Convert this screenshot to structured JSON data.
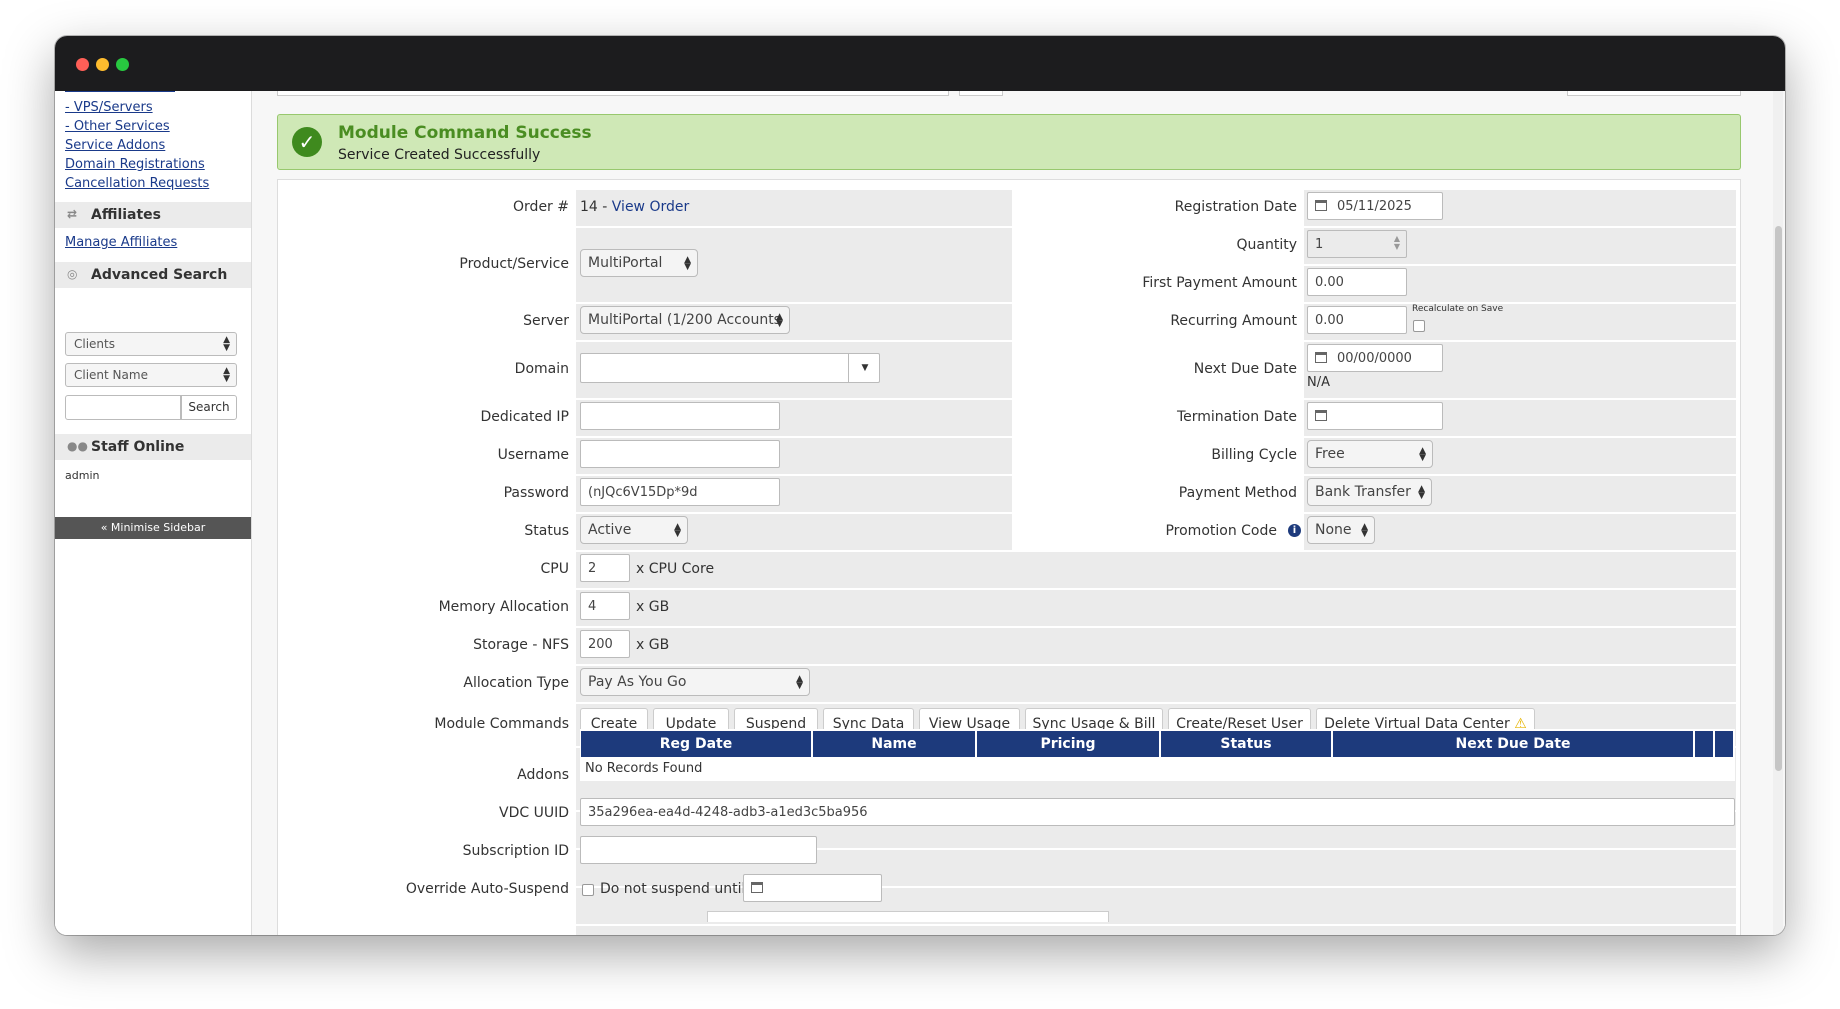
{
  "sidebar": {
    "links_top": [
      "- VPS/Servers",
      "- Other Services",
      "Service Addons",
      "Domain Registrations",
      "Cancellation Requests"
    ],
    "affiliates": {
      "title": "Affiliates",
      "link": "Manage Affiliates"
    },
    "advanced_search": {
      "title": "Advanced Search",
      "select1": "Clients",
      "select2": "Client Name",
      "search_button": "Search"
    },
    "staff_online": {
      "title": "Staff Online",
      "user": "admin"
    },
    "minimise": "« Minimise Sidebar"
  },
  "alert": {
    "title": "Module Command Success",
    "message": "Service Created Successfully"
  },
  "form": {
    "order_label": "Order #",
    "order_number": "14 - ",
    "view_order": "View Order",
    "product_label": "Product/Service",
    "product_value": "MultiPortal",
    "server_label": "Server",
    "server_value": "MultiPortal (1/200 Accounts",
    "domain_label": "Domain",
    "domain_value": "",
    "dedicated_ip_label": "Dedicated IP",
    "dedicated_ip_value": "",
    "username_label": "Username",
    "username_value": "",
    "password_label": "Password",
    "password_value": "(nJQc6V15Dp*9d",
    "status_label": "Status",
    "status_value": "Active",
    "registration_date_label": "Registration Date",
    "registration_date_value": "05/11/2025",
    "quantity_label": "Quantity",
    "quantity_value": "1",
    "first_payment_label": "First Payment Amount",
    "first_payment_value": "0.00",
    "recurring_label": "Recurring Amount",
    "recurring_value": "0.00",
    "recalculate_label": "Recalculate on Save",
    "next_due_label": "Next Due Date",
    "next_due_value": "00/00/0000",
    "next_due_note": "N/A",
    "termination_label": "Termination Date",
    "termination_value": "",
    "billing_cycle_label": "Billing Cycle",
    "billing_cycle_value": "Free",
    "payment_method_label": "Payment Method",
    "payment_method_value": "Bank Transfer",
    "promotion_label": "Promotion Code",
    "promotion_value": "None",
    "cpu_label": "CPU",
    "cpu_value": "2",
    "cpu_unit": "x CPU Core",
    "memory_label": "Memory Allocation",
    "memory_value": "4",
    "memory_unit": "x GB",
    "storage_label": "Storage - NFS",
    "storage_value": "200",
    "storage_unit": "x GB",
    "allocation_label": "Allocation Type",
    "allocation_value": "Pay As You Go",
    "module_commands_label": "Module Commands",
    "module_commands": [
      "Create",
      "Update",
      "Suspend",
      "Sync Data",
      "View Usage",
      "Sync Usage & Bill",
      "Create/Reset User",
      "Delete Virtual Data Center"
    ],
    "addons_label": "Addons",
    "addons_headers": [
      "Reg Date",
      "Name",
      "Pricing",
      "Status",
      "Next Due Date"
    ],
    "addons_empty": "No Records Found",
    "vdc_uuid_label": "VDC UUID",
    "vdc_uuid_value": "35a296ea-ea4d-4248-adb3-a1ed3c5ba956",
    "subscription_label": "Subscription ID",
    "subscription_value": "",
    "override_label": "Override Auto-Suspend",
    "override_checkbox_label": "Do not suspend until",
    "override_date": ""
  },
  "colors": {
    "accent": "#1d3a7c",
    "success_bg": "#cfe8b6",
    "success_text": "#4a8d22",
    "link": "#1a3a8a"
  }
}
